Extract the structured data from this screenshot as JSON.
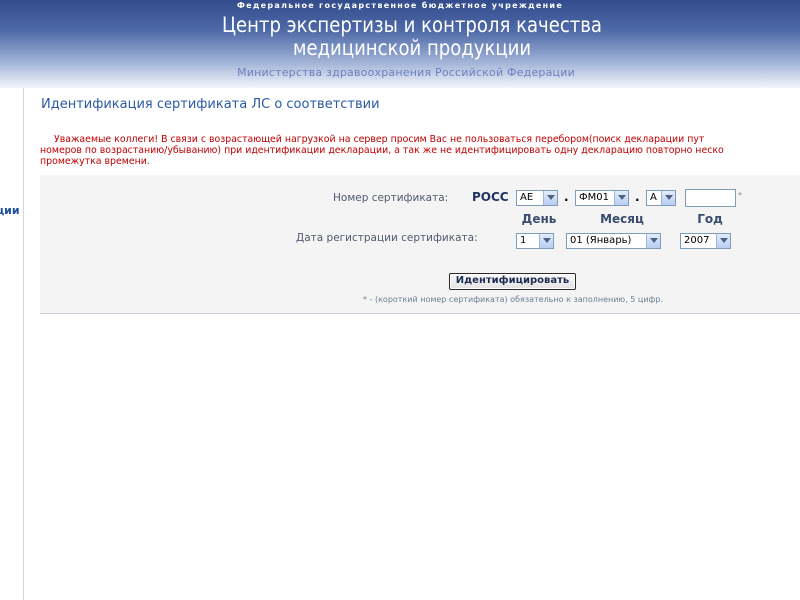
{
  "header": {
    "overline": "Федеральное государственное бюджетное учреждение",
    "title_line1": "Центр экспертизы и контроля качества",
    "title_line2": "медицинской продукции",
    "ministry": "Министерства здравоохранения Российской Федерации"
  },
  "sidebar": {
    "fragment": "ции"
  },
  "page": {
    "title": "Идентификация сертификата ЛС о соответствии"
  },
  "notice": {
    "line1": "Уважаемые коллеги! В связи с возрастающей нагрузкой на сервер просим Вас не пользоваться перебором(поиск декларации пут",
    "line2": "номеров по возрастанию/убыванию) при идентификации декларации, а так же не идентифицировать одну декларацию повторно неско",
    "line3": "промежутка времени."
  },
  "form": {
    "cert_label": "Номер сертификата:",
    "cert_prefix": "РОСС",
    "cert_part1": "АЕ",
    "cert_part2": "ФМ01",
    "cert_part3": "А",
    "dot": ".",
    "required_mark": "*",
    "col_day": "День",
    "col_month": "Месяц",
    "col_year": "Год",
    "date_label": "Дата регистрации сертификата:",
    "day": "1",
    "month": "01 (Январь)",
    "year": "2007",
    "submit": "Идентифицировать",
    "footnote": "* - (короткий номер сертификата) обязательно к заполнению, 5 цифр."
  },
  "colors": {
    "header_dark": "#324b8c",
    "title_blue": "#2b5aa5",
    "notice_red": "#c00000",
    "panel_bg": "#f4f4f4"
  }
}
